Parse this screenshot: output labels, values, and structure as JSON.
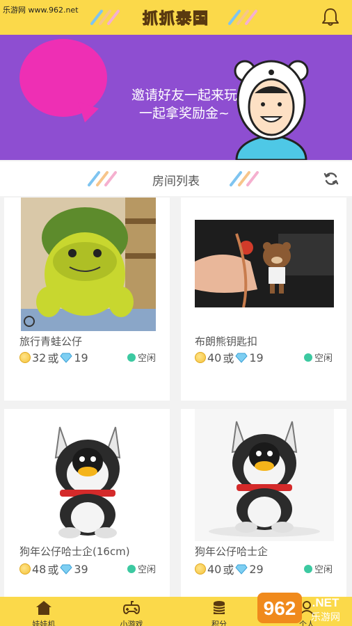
{
  "watermark": "乐游网 www.962.net",
  "header": {
    "title": "抓抓泰国"
  },
  "banner": {
    "line1": "邀请好友一起来玩",
    "line2": "一起拿奖励金~"
  },
  "section": {
    "title": "房间列表"
  },
  "rooms": [
    {
      "name": "旅行青蛙公仔",
      "coins": "32",
      "or": "或",
      "gems": "19",
      "status": "空闲"
    },
    {
      "name": "布朗熊钥匙扣",
      "coins": "40",
      "or": "或",
      "gems": "19",
      "status": "空闲"
    },
    {
      "name": "狗年公仔哈士企(16cm)",
      "coins": "48",
      "or": "或",
      "gems": "39",
      "status": "空闲"
    },
    {
      "name": "狗年公仔哈士企",
      "coins": "40",
      "or": "或",
      "gems": "29",
      "status": "空闲"
    }
  ],
  "nav": [
    {
      "label": "娃娃机",
      "icon": "home-icon"
    },
    {
      "label": "小游戏",
      "icon": "gamepad-icon"
    },
    {
      "label": "积分",
      "icon": "coins-icon"
    },
    {
      "label": "个人",
      "icon": "person-icon"
    }
  ],
  "logo": {
    "text1": "962",
    "text2": ".NET",
    "text3": "乐游网"
  },
  "colors": {
    "header": "#fbd94a",
    "banner": "#8e4ed1",
    "pink": "#ee2fb4",
    "status": "#3cc9a1"
  }
}
